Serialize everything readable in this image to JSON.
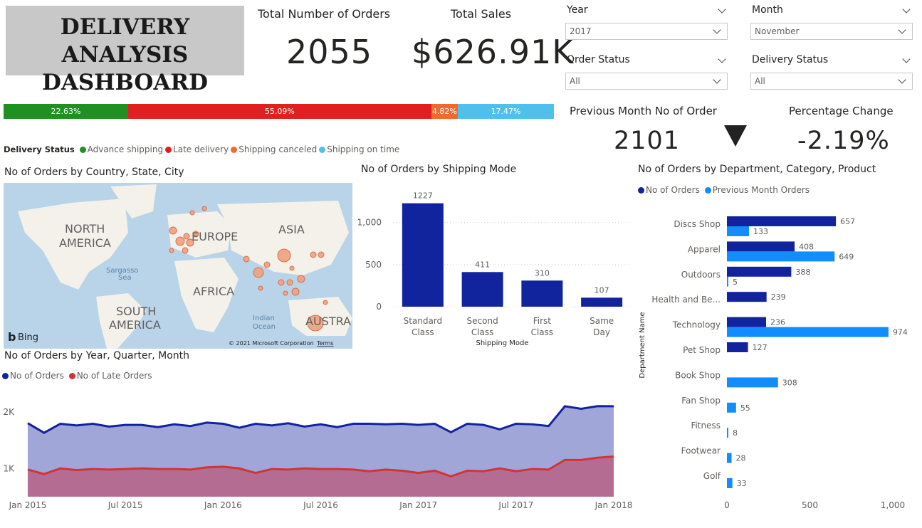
{
  "title": {
    "line1": "DELIVERY ANALYSIS",
    "line2": "DASHBOARD"
  },
  "kpis": {
    "orders_label": "Total Number of Orders",
    "orders_value": "2055",
    "sales_label": "Total Sales",
    "sales_value": "$626.91K",
    "prev_label": "Previous Month No of Order",
    "prev_value": "2101",
    "pct_label": "Percentage Change",
    "pct_value": "-2.19%"
  },
  "slicers": {
    "year": {
      "label": "Year",
      "value": "2017"
    },
    "month": {
      "label": "Month",
      "value": "November"
    },
    "order_status": {
      "label": "Order Status",
      "value": "All"
    },
    "delivery_status": {
      "label": "Delivery Status",
      "value": "All"
    }
  },
  "delivery_bar": {
    "legend_title": "Delivery Status",
    "segments": [
      {
        "name": "Advance shipping",
        "label": "22.63%",
        "value": 22.63,
        "color": "#1e9120"
      },
      {
        "name": "Late delivery",
        "label": "55.09%",
        "value": 55.09,
        "color": "#e01f1f"
      },
      {
        "name": "Shipping canceled",
        "label": "4.82%",
        "value": 4.82,
        "color": "#f2692c"
      },
      {
        "name": "Shipping on time",
        "label": "17.47%",
        "value": 17.47,
        "color": "#4ec0eb"
      }
    ]
  },
  "map": {
    "title": "No of Orders by Country, State, City",
    "labels": {
      "north_america": "NORTH AMERICA",
      "europe": "EUROPE",
      "asia": "ASIA",
      "africa": "AFRICA",
      "south_america": "SOUTH AMERICA",
      "australia": "AUSTRA",
      "sargasso": "Sargasso Sea",
      "indian_ocean": "Indian Ocean"
    },
    "bing": "Bing",
    "copyright": "© 2021 Microsoft Corporation",
    "terms": "Terms"
  },
  "chart_data": [
    {
      "type": "bar",
      "title": "No of Orders by Shipping Mode",
      "xlabel": "Shipping Mode",
      "categories": [
        "Standard Class",
        "Second Class",
        "First Class",
        "Same Day"
      ],
      "values": [
        1227,
        411,
        310,
        107
      ],
      "ylim": [
        0,
        1300
      ],
      "yticks": [
        0,
        500,
        1000
      ],
      "ytick_labels": [
        "0",
        "500",
        "1,000"
      ],
      "color": "#12239e"
    },
    {
      "type": "bar",
      "orientation": "horizontal",
      "title": "No of Orders by Department, Category, Product",
      "ylabel": "Department Name",
      "categories": [
        "Discs Shop",
        "Apparel",
        "Outdoors",
        "Health and Be...",
        "Technology",
        "Pet Shop",
        "Book Shop",
        "Fan Shop",
        "Fitness",
        "Footwear",
        "Golf"
      ],
      "series": [
        {
          "name": "No of Orders",
          "color": "#12239e",
          "values": [
            657,
            408,
            388,
            239,
            236,
            127,
            null,
            null,
            null,
            null,
            null
          ]
        },
        {
          "name": "Previous Month Orders",
          "color": "#118dff",
          "values": [
            133,
            649,
            5,
            null,
            974,
            null,
            308,
            55,
            8,
            28,
            33
          ]
        }
      ],
      "xlim": [
        0,
        1000
      ],
      "xticks": [
        0,
        500,
        1000
      ],
      "xtick_labels": [
        "0",
        "500",
        "1,000"
      ]
    },
    {
      "type": "area",
      "title": "No of Orders by Year, Quarter, Month",
      "x": [
        "2015-01",
        "2015-02",
        "2015-03",
        "2015-04",
        "2015-05",
        "2015-06",
        "2015-07",
        "2015-08",
        "2015-09",
        "2015-10",
        "2015-11",
        "2015-12",
        "2016-01",
        "2016-02",
        "2016-03",
        "2016-04",
        "2016-05",
        "2016-06",
        "2016-07",
        "2016-08",
        "2016-09",
        "2016-10",
        "2016-11",
        "2016-12",
        "2017-01",
        "2017-02",
        "2017-03",
        "2017-04",
        "2017-05",
        "2017-06",
        "2017-07",
        "2017-08",
        "2017-09",
        "2017-10",
        "2017-11",
        "2017-12",
        "2018-01"
      ],
      "xtick_labels": [
        "Jan 2015",
        "Jul 2015",
        "Jan 2016",
        "Jul 2016",
        "Jan 2017",
        "Jul 2017",
        "Jan 2018"
      ],
      "series": [
        {
          "name": "No of Orders",
          "color": "#12239e",
          "values": [
            1800,
            1630,
            1790,
            1760,
            1790,
            1740,
            1770,
            1770,
            1730,
            1780,
            1750,
            1810,
            1790,
            1720,
            1790,
            1760,
            1800,
            1740,
            1780,
            1730,
            1790,
            1790,
            1780,
            1790,
            1770,
            1790,
            1640,
            1790,
            1770,
            1690,
            1790,
            1780,
            1750,
            2100,
            2055,
            2101,
            2100
          ]
        },
        {
          "name": "No of Late Orders",
          "color": "#d13438",
          "values": [
            980,
            900,
            1000,
            970,
            990,
            980,
            990,
            1000,
            990,
            990,
            980,
            1020,
            1030,
            1000,
            920,
            990,
            980,
            1000,
            990,
            990,
            980,
            950,
            980,
            960,
            920,
            960,
            860,
            960,
            950,
            1000,
            950,
            990,
            980,
            1150,
            1150,
            1190,
            1210
          ]
        }
      ],
      "ylim": [
        500,
        2300
      ],
      "yticks": [
        1000,
        2000
      ],
      "ytick_labels": [
        "1K",
        "2K"
      ]
    }
  ]
}
